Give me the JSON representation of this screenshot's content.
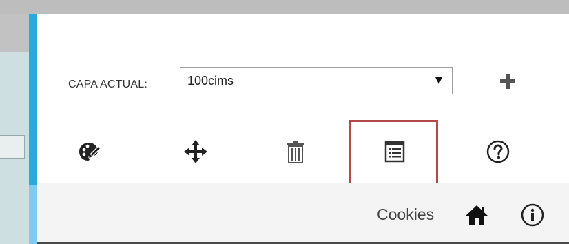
{
  "layer": {
    "label": "CAPA ACTUAL:",
    "selected": "100cims"
  },
  "toolbar": {
    "add": "plus-icon",
    "tools": [
      {
        "icon": "palette-icon"
      },
      {
        "icon": "move-icon"
      },
      {
        "icon": "trash-icon"
      },
      {
        "icon": "table-icon",
        "highlighted": true
      },
      {
        "icon": "help-icon"
      }
    ]
  },
  "footer": {
    "cookies_label": "Cookies",
    "home_icon": "home-icon",
    "info_icon": "info-icon"
  },
  "colors": {
    "accent": "#2aa8e0",
    "highlight": "#b5484a",
    "icon": "#222222"
  }
}
